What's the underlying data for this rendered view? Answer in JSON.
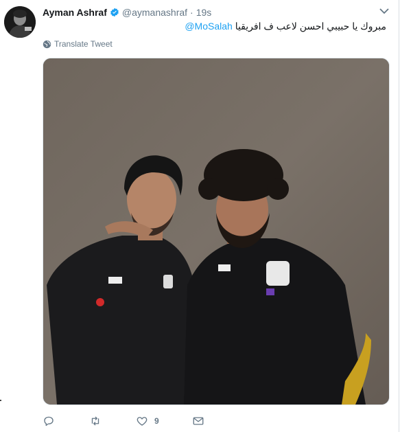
{
  "tweet": {
    "author_name": "Ayman Ashraf",
    "handle": "@aymanashraf",
    "separator": "·",
    "time": "19s",
    "text_mention": "@MoSalah",
    "text_body": "مبروك يا حبيبي احسن لاعب ف افريقيا",
    "translate_label": "Translate Tweet",
    "like_count": "9"
  },
  "colors": {
    "link": "#1da1f2",
    "secondary_text": "#657786",
    "verified": "#1da1f2"
  },
  "icons": {
    "verified": "verified-badge-icon",
    "caret": "chevron-down-icon",
    "globe": "globe-icon",
    "reply": "reply-icon",
    "retweet": "retweet-icon",
    "like": "heart-icon",
    "message": "envelope-icon"
  }
}
